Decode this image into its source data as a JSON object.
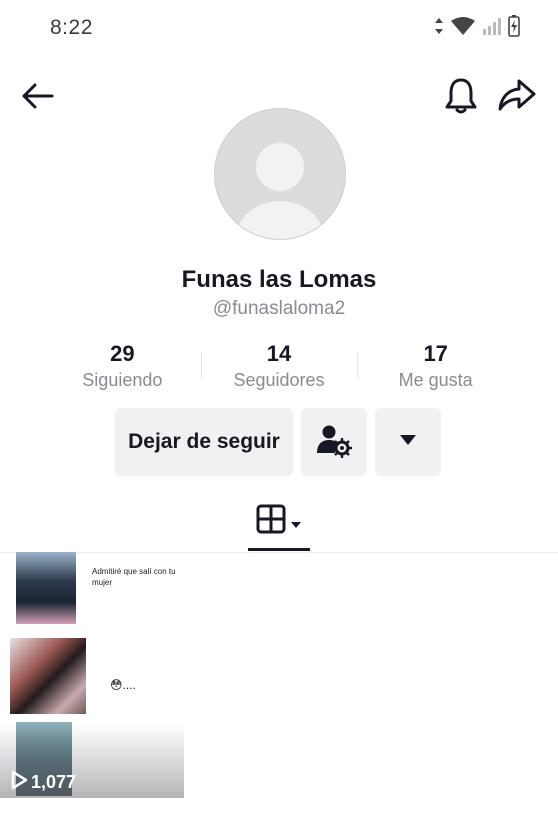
{
  "status_bar": {
    "time": "8:22",
    "icons": [
      "data-arrows-icon",
      "wifi-icon",
      "signal-icon",
      "battery-icon"
    ]
  },
  "header": {
    "back_icon": "arrow-left-icon",
    "bell_icon": "bell-icon",
    "share_icon": "share-icon"
  },
  "profile": {
    "display_name": "Funas las Lomas",
    "username": "@funaslaloma2",
    "avatar": "default-avatar"
  },
  "stats": [
    {
      "value": "29",
      "label": "Siguiendo"
    },
    {
      "value": "14",
      "label": "Seguidores"
    },
    {
      "value": "17",
      "label": "Me gusta"
    }
  ],
  "actions": {
    "unfollow_label": "Dejar de seguir",
    "friends_icon": "user-settings-icon",
    "more_icon": "caret-down-icon"
  },
  "tabs": {
    "active": "grid-icon"
  },
  "videos": [
    {
      "caption": "Admitiré que salí con tu mujer"
    },
    {
      "caption": "😳...."
    },
    {
      "views": "1,077",
      "play_icon": "play-outline-icon"
    }
  ],
  "colors": {
    "text": "#161823",
    "muted": "#8a8b91",
    "button_bg": "#f1f1f2",
    "avatar_bg": "#dcdcdc"
  }
}
